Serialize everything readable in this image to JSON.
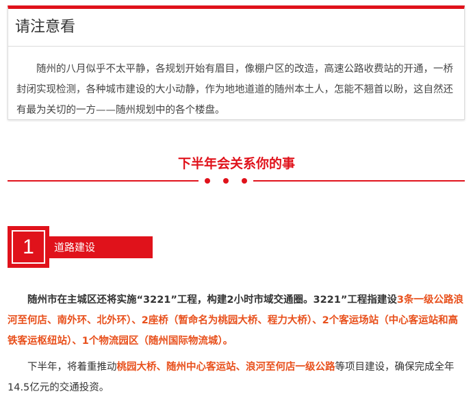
{
  "notice": {
    "title": "请注意看",
    "body": "随州的八月似乎不太平静，各规划开始有眉目，像棚户区的改造，高速公路收费站的开通，一桥封闭实现检测，各种城市建设的大小动静，作为地地道道的随州本土人，怎能不翘首以盼，这自然还有最为关切的一方——随州规划中的各个楼盘。"
  },
  "section": {
    "title": "下半年会关系你的事"
  },
  "item1": {
    "number": "1",
    "label": "道路建设"
  },
  "paragraph1": {
    "text_a": "随州市在主城区还将实施“3221”工程，构建2小时市域交通圈。3221”工程指建设",
    "highlight": "3条一级公路浪河至何店、南外环、北外环）、2座桥（暂命名为桃园大桥、程力大桥）、2个客运场站（中心客运站和高铁客运枢纽站）、1个物流园区（随州国际物流城）。"
  },
  "paragraph2": {
    "text_a": "下半年，将着重推动",
    "highlight": "桃园大桥、随州中心客运站、浪河至何店一级公路",
    "text_b": "等项目建设，确保完成全年14.5亿元的交通投资。"
  },
  "colors": {
    "accent": "#e0121b",
    "highlight": "#e8501c"
  }
}
